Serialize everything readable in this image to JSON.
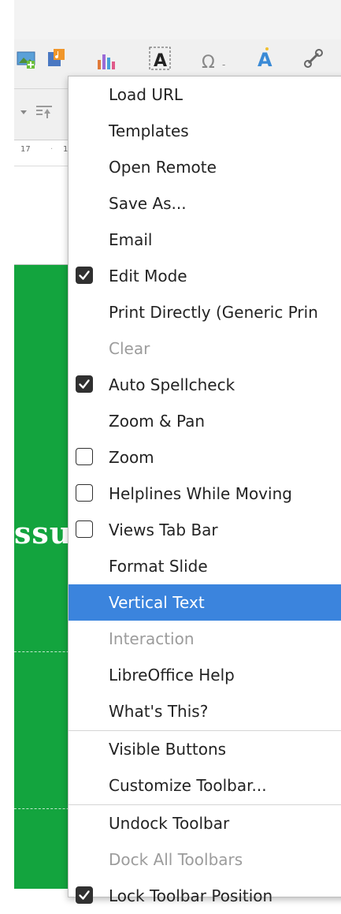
{
  "toolbar": {
    "ruler_ticks": [
      "17",
      "1"
    ]
  },
  "slide": {
    "visible_text": "ssu"
  },
  "context_menu": {
    "items": [
      {
        "label": "Load URL",
        "checkbox": "none",
        "enabled": true,
        "highlighted": false
      },
      {
        "label": "Templates",
        "checkbox": "none",
        "enabled": true,
        "highlighted": false
      },
      {
        "label": "Open Remote",
        "checkbox": "none",
        "enabled": true,
        "highlighted": false
      },
      {
        "label": "Save As...",
        "checkbox": "none",
        "enabled": true,
        "highlighted": false
      },
      {
        "label": "Email",
        "checkbox": "none",
        "enabled": true,
        "highlighted": false
      },
      {
        "label": "Edit Mode",
        "checkbox": "checked",
        "enabled": true,
        "highlighted": false
      },
      {
        "label": "Print Directly (Generic Prin",
        "checkbox": "none",
        "enabled": true,
        "highlighted": false
      },
      {
        "label": "Clear",
        "checkbox": "none",
        "enabled": false,
        "highlighted": false
      },
      {
        "label": "Auto Spellcheck",
        "checkbox": "checked",
        "enabled": true,
        "highlighted": false
      },
      {
        "label": "Zoom & Pan",
        "checkbox": "none",
        "enabled": true,
        "highlighted": false
      },
      {
        "label": "Zoom",
        "checkbox": "unchecked",
        "enabled": true,
        "highlighted": false
      },
      {
        "label": "Helplines While Moving",
        "checkbox": "unchecked",
        "enabled": true,
        "highlighted": false
      },
      {
        "label": "Views Tab Bar",
        "checkbox": "unchecked",
        "enabled": true,
        "highlighted": false
      },
      {
        "label": "Format Slide",
        "checkbox": "none",
        "enabled": true,
        "highlighted": false
      },
      {
        "label": "Vertical Text",
        "checkbox": "none",
        "enabled": true,
        "highlighted": true
      },
      {
        "label": "Interaction",
        "checkbox": "none",
        "enabled": false,
        "highlighted": false
      },
      {
        "label": "LibreOffice Help",
        "checkbox": "none",
        "enabled": true,
        "highlighted": false
      },
      {
        "label": "What's This?",
        "checkbox": "none",
        "enabled": true,
        "highlighted": false
      },
      {
        "label": "Visible Buttons",
        "checkbox": "none",
        "enabled": true,
        "highlighted": false
      },
      {
        "label": "Customize Toolbar...",
        "checkbox": "none",
        "enabled": true,
        "highlighted": false
      },
      {
        "label": "Undock Toolbar",
        "checkbox": "none",
        "enabled": true,
        "highlighted": false
      },
      {
        "label": "Dock All Toolbars",
        "checkbox": "none",
        "enabled": false,
        "highlighted": false
      },
      {
        "label": "Lock Toolbar Position",
        "checkbox": "checked",
        "enabled": true,
        "highlighted": false
      }
    ]
  },
  "colors": {
    "highlight": "#3b84dd",
    "slide_background": "#13a43e",
    "disabled_text": "#9c9c9c"
  }
}
